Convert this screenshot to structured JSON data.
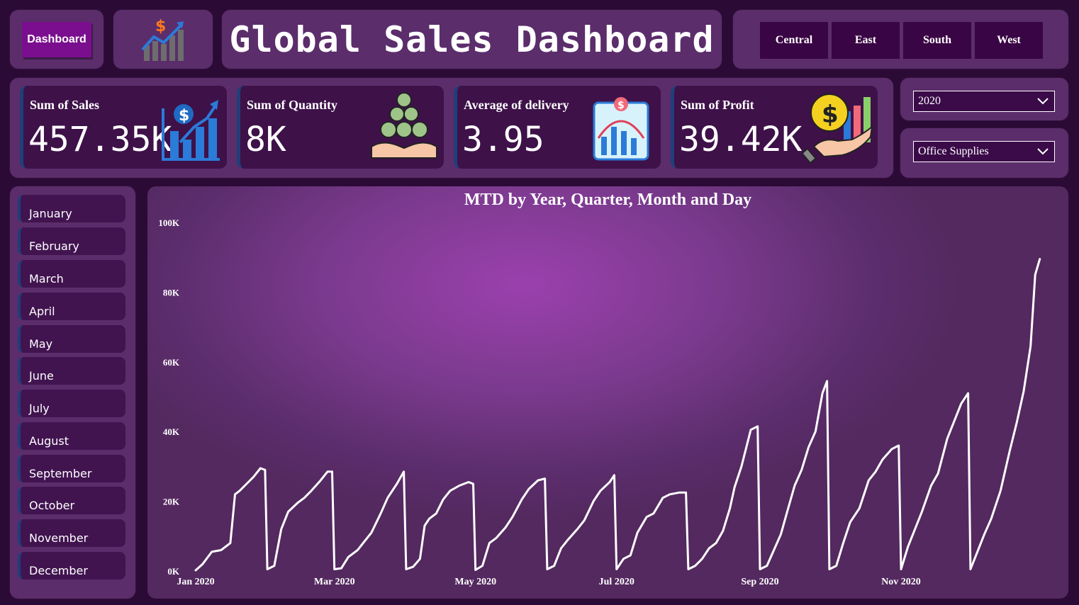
{
  "nav": {
    "dashboard_label": "Dashboard"
  },
  "header": {
    "title": "Global Sales Dashboard"
  },
  "regions": [
    "Central",
    "East",
    "South",
    "West"
  ],
  "kpis": [
    {
      "label": "Sum of Sales",
      "value": "457.35K",
      "icon": "sales-growth-icon"
    },
    {
      "label": "Sum of Quantity",
      "value": "8K",
      "icon": "coins-hand-icon"
    },
    {
      "label": "Average of delivery",
      "value": "3.95",
      "icon": "bar-chart-icon"
    },
    {
      "label": "Sum of Profit",
      "value": "39.42K",
      "icon": "profit-hand-icon"
    }
  ],
  "filters": {
    "year": "2020",
    "category": "Office Supplies"
  },
  "months": [
    "January",
    "February",
    "March",
    "April",
    "May",
    "June",
    "July",
    "August",
    "September",
    "October",
    "November",
    "December"
  ],
  "colors": {
    "accent": "#7a0e8e",
    "panel": "#5b2d6b",
    "card": "#3e1149",
    "line": "#ffffff"
  },
  "chart_data": {
    "type": "line",
    "title": "MTD by Year, Quarter, Month and Day",
    "xlabel": "",
    "ylabel": "",
    "ylim": [
      0,
      100000
    ],
    "y_ticks": [
      "0K",
      "20K",
      "40K",
      "60K",
      "80K",
      "100K"
    ],
    "x_ticks": [
      "Jan 2020",
      "Mar 2020",
      "May 2020",
      "Jul 2020",
      "Sep 2020",
      "Nov 2020"
    ],
    "series": [
      {
        "months": [
          {
            "start": 0,
            "days": 31,
            "points": [
              [
                1,
                200
              ],
              [
                4,
                2000
              ],
              [
                8,
                5500
              ],
              [
                12,
                6000
              ],
              [
                16,
                8000
              ],
              [
                18,
                22000
              ],
              [
                20,
                23000
              ],
              [
                23,
                25000
              ],
              [
                26,
                27000
              ],
              [
                29,
                29500
              ],
              [
                31,
                29000
              ]
            ]
          },
          {
            "start": 31,
            "days": 29,
            "points": [
              [
                1,
                500
              ],
              [
                4,
                1500
              ],
              [
                7,
                12000
              ],
              [
                10,
                17000
              ],
              [
                14,
                19500
              ],
              [
                17,
                21000
              ],
              [
                20,
                23000
              ],
              [
                24,
                26000
              ],
              [
                27,
                28500
              ],
              [
                29,
                28500
              ]
            ]
          },
          {
            "start": 60,
            "days": 31,
            "points": [
              [
                1,
                500
              ],
              [
                4,
                800
              ],
              [
                7,
                4000
              ],
              [
                11,
                6000
              ],
              [
                14,
                8500
              ],
              [
                17,
                11000
              ],
              [
                21,
                16500
              ],
              [
                24,
                21000
              ],
              [
                28,
                25000
              ],
              [
                31,
                28500
              ]
            ]
          },
          {
            "start": 91,
            "days": 30,
            "points": [
              [
                1,
                500
              ],
              [
                4,
                1200
              ],
              [
                7,
                3500
              ],
              [
                9,
                13000
              ],
              [
                11,
                15000
              ],
              [
                14,
                16500
              ],
              [
                17,
                20500
              ],
              [
                20,
                23000
              ],
              [
                24,
                24500
              ],
              [
                28,
                25500
              ],
              [
                30,
                25000
              ]
            ]
          },
          {
            "start": 121,
            "days": 31,
            "points": [
              [
                1,
                300
              ],
              [
                4,
                1500
              ],
              [
                7,
                8000
              ],
              [
                10,
                9500
              ],
              [
                14,
                12500
              ],
              [
                17,
                15500
              ],
              [
                21,
                20500
              ],
              [
                24,
                23500
              ],
              [
                28,
                26000
              ],
              [
                31,
                26500
              ]
            ]
          },
          {
            "start": 152,
            "days": 30,
            "points": [
              [
                1,
                500
              ],
              [
                4,
                1500
              ],
              [
                7,
                6500
              ],
              [
                10,
                9000
              ],
              [
                14,
                12000
              ],
              [
                17,
                14500
              ],
              [
                21,
                20000
              ],
              [
                24,
                23000
              ],
              [
                28,
                25500
              ],
              [
                30,
                27500
              ]
            ]
          },
          {
            "start": 182,
            "days": 31,
            "points": [
              [
                1,
                500
              ],
              [
                4,
                3500
              ],
              [
                7,
                4500
              ],
              [
                10,
                11000
              ],
              [
                14,
                15500
              ],
              [
                17,
                16500
              ],
              [
                21,
                21000
              ],
              [
                24,
                22000
              ],
              [
                28,
                22500
              ],
              [
                31,
                22500
              ]
            ]
          },
          {
            "start": 213,
            "days": 31,
            "points": [
              [
                1,
                500
              ],
              [
                4,
                1500
              ],
              [
                7,
                3500
              ],
              [
                10,
                6500
              ],
              [
                13,
                8000
              ],
              [
                16,
                11500
              ],
              [
                19,
                18000
              ],
              [
                21,
                24000
              ],
              [
                24,
                30000
              ],
              [
                28,
                40500
              ],
              [
                31,
                41500
              ]
            ]
          },
          {
            "start": 244,
            "days": 30,
            "points": [
              [
                1,
                500
              ],
              [
                4,
                1500
              ],
              [
                7,
                6000
              ],
              [
                10,
                10500
              ],
              [
                13,
                17500
              ],
              [
                16,
                24500
              ],
              [
                19,
                29000
              ],
              [
                22,
                35500
              ],
              [
                25,
                40000
              ],
              [
                28,
                51000
              ],
              [
                30,
                54500
              ]
            ]
          },
          {
            "start": 274,
            "days": 31,
            "points": [
              [
                1,
                500
              ],
              [
                4,
                1500
              ],
              [
                7,
                8000
              ],
              [
                10,
                14000
              ],
              [
                14,
                18000
              ],
              [
                18,
                26000
              ],
              [
                21,
                28500
              ],
              [
                24,
                32000
              ],
              [
                28,
                35000
              ],
              [
                31,
                36000
              ]
            ]
          },
          {
            "start": 305,
            "days": 30,
            "points": [
              [
                1,
                500
              ],
              [
                4,
                7000
              ],
              [
                7,
                12000
              ],
              [
                10,
                17000
              ],
              [
                14,
                24500
              ],
              [
                17,
                28000
              ],
              [
                21,
                38000
              ],
              [
                24,
                43000
              ],
              [
                27,
                48000
              ],
              [
                30,
                51000
              ]
            ]
          },
          {
            "start": 335,
            "days": 31,
            "points": [
              [
                1,
                500
              ],
              [
                4,
                5500
              ],
              [
                7,
                10500
              ],
              [
                10,
                15000
              ],
              [
                14,
                23000
              ],
              [
                18,
                34500
              ],
              [
                21,
                42500
              ],
              [
                24,
                51500
              ],
              [
                27,
                64500
              ],
              [
                29,
                85000
              ],
              [
                31,
                89500
              ]
            ]
          }
        ]
      }
    ]
  }
}
